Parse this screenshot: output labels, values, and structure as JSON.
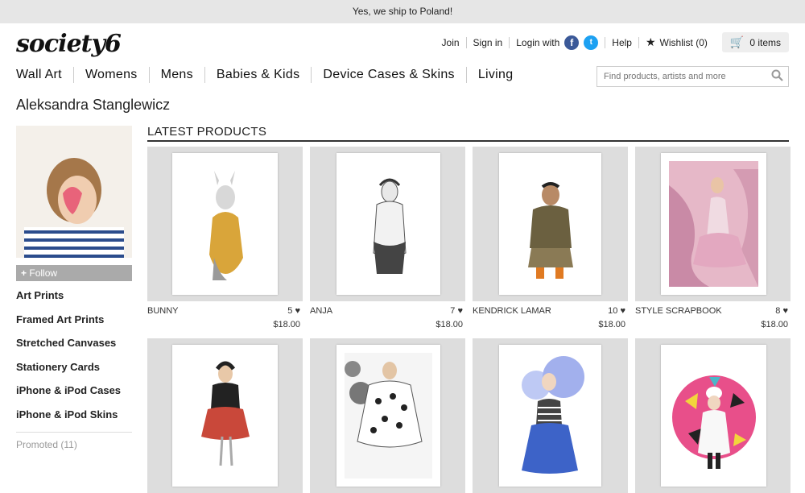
{
  "banner": {
    "text": "Yes, we ship to Poland!"
  },
  "header": {
    "logo": "society6",
    "join": "Join",
    "sign_in": "Sign in",
    "login_with": "Login with",
    "help": "Help",
    "wishlist": "Wishlist (0)",
    "cart": "0 items"
  },
  "nav": {
    "items": [
      "Wall Art",
      "Womens",
      "Mens",
      "Babies & Kids",
      "Device Cases & Skins",
      "Living"
    ]
  },
  "search": {
    "placeholder": "Find products, artists and more"
  },
  "artist": {
    "name": "Aleksandra Stanglewicz"
  },
  "sidebar": {
    "follow": "Follow",
    "items": [
      "Art Prints",
      "Framed Art Prints",
      "Stretched Canvases",
      "Stationery Cards",
      "iPhone & iPod Cases",
      "iPhone & iPod Skins"
    ],
    "promoted": "Promoted (11)"
  },
  "section": {
    "title": "LATEST PRODUCTS"
  },
  "products": [
    {
      "title": "BUNNY",
      "likes": "5",
      "price": "$18.00"
    },
    {
      "title": "ANJA",
      "likes": "7",
      "price": "$18.00"
    },
    {
      "title": "KENDRICK LAMAR",
      "likes": "10",
      "price": "$18.00"
    },
    {
      "title": "STYLE SCRAPBOOK",
      "likes": "8",
      "price": "$18.00"
    }
  ],
  "colors": {
    "accent": "#333333",
    "follow_bg": "#aaaaaa",
    "facebook": "#3b5998",
    "twitter": "#1da1f2"
  }
}
